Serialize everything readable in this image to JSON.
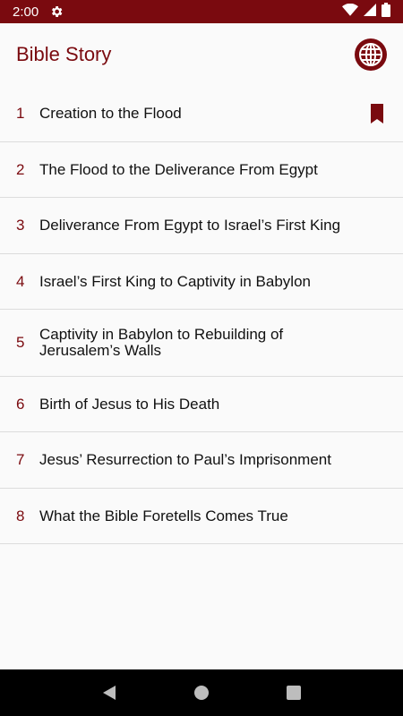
{
  "status_bar": {
    "time": "2:00"
  },
  "app_bar": {
    "title": "Bible Story"
  },
  "stories": [
    {
      "number": "1",
      "title": "Creation to the Flood",
      "bookmarked": true
    },
    {
      "number": "2",
      "title": "The Flood to the Deliverance From Egypt",
      "bookmarked": false
    },
    {
      "number": "3",
      "title": "Deliverance From Egypt to Israel’s First King",
      "bookmarked": false
    },
    {
      "number": "4",
      "title": "Israel’s First King to Captivity in Babylon",
      "bookmarked": false
    },
    {
      "number": "5",
      "title": "Captivity in Babylon to Rebuilding of Jerusalem’s Walls",
      "bookmarked": false
    },
    {
      "number": "6",
      "title": "Birth of Jesus to His Death",
      "bookmarked": false
    },
    {
      "number": "7",
      "title": "Jesus’ Resurrection to Paul’s Imprisonment",
      "bookmarked": false
    },
    {
      "number": "8",
      "title": "What the Bible Foretells Comes True",
      "bookmarked": false
    }
  ],
  "colors": {
    "accent": "#7a0a0f",
    "background": "#fafafa",
    "divider": "#dcdcdc"
  },
  "icons": {
    "status": [
      "gear-icon",
      "wifi-icon",
      "signal-icon",
      "battery-icon"
    ],
    "app_bar": "globe-icon",
    "row": "bookmark-icon",
    "nav": [
      "back-icon",
      "home-icon",
      "recents-icon"
    ]
  }
}
